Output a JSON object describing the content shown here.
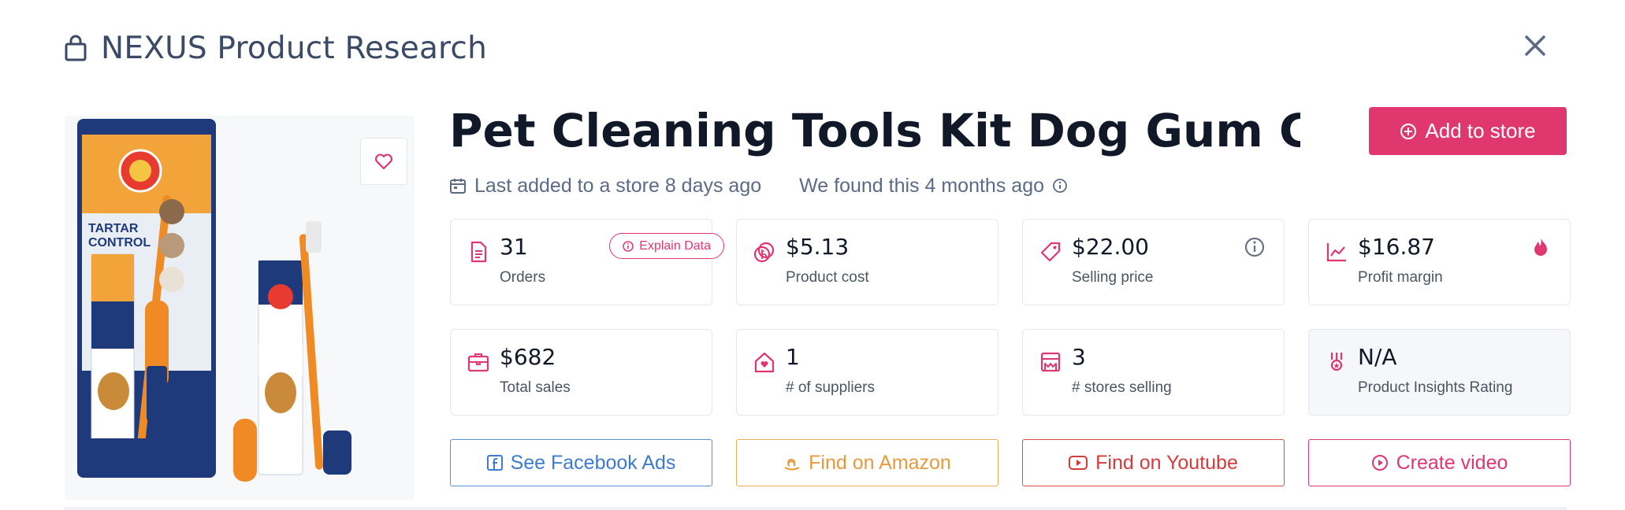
{
  "header": {
    "icon": "shopping-bag-icon",
    "title": "NEXUS Product Research",
    "close_icon": "close-icon"
  },
  "product": {
    "title": "Pet Cleaning Tools Kit Dog Gum Care ...",
    "image_icon": "product-image",
    "favorite_icon": "heart-icon"
  },
  "actions": {
    "add_to_store": "Add to store"
  },
  "meta": {
    "last_added": "Last added to a store 8 days ago",
    "found": "We found this 4 months ago"
  },
  "stats": [
    {
      "value": "31",
      "label": "Orders",
      "icon": "document-icon"
    },
    {
      "value": "$5.13",
      "label": "Product cost",
      "icon": "coins-icon"
    },
    {
      "value": "$22.00",
      "label": "Selling price",
      "icon": "price-tag-icon"
    },
    {
      "value": "$16.87",
      "label": "Profit margin",
      "icon": "trend-chart-icon"
    },
    {
      "value": "$682",
      "label": "Total sales",
      "icon": "briefcase-icon"
    },
    {
      "value": "1",
      "label": "# of suppliers",
      "icon": "supplier-house-icon"
    },
    {
      "value": "3",
      "label": "# stores selling",
      "icon": "store-icon"
    },
    {
      "value": "N/A",
      "label": "Product Insights Rating",
      "icon": "award-icon"
    }
  ],
  "explain_data": "Explain Data",
  "buttons": {
    "facebook": "See Facebook Ads",
    "amazon": "Find on Amazon",
    "youtube": "Find on Youtube",
    "video": "Create video"
  },
  "colors": {
    "accent": "#e0376f",
    "facebook": "#3d7bd0",
    "amazon": "#e69a3d",
    "youtube": "#d63b3b",
    "muted_text": "#5b6a85"
  }
}
